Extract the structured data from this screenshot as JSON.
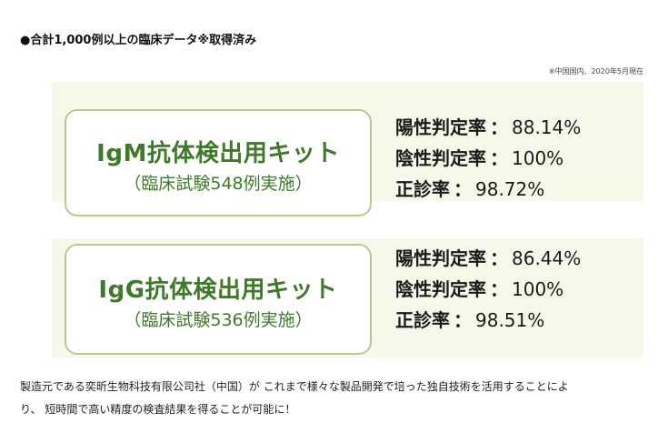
{
  "heading": "●合計1,000例以上の臨床データ※取得済み",
  "note": "※中国国内、2020年5月現在",
  "kits": [
    {
      "name": "IgM抗体検出用キット",
      "trial": "（臨床試験548例実施）",
      "stats": [
        {
          "label": "陽性判定率",
          "sep": "：",
          "value": "88.14%"
        },
        {
          "label": "陰性判定率",
          "sep": "：",
          "value": "100%"
        },
        {
          "label": "正診率",
          "sep": "：",
          "value": "98.72%"
        }
      ]
    },
    {
      "name": "IgG抗体検出用キット",
      "trial": "（臨床試験536例実施）",
      "stats": [
        {
          "label": "陽性判定率",
          "sep": "：",
          "value": "86.44%"
        },
        {
          "label": "陰性判定率",
          "sep": "：",
          "value": "100%"
        },
        {
          "label": "正診率",
          "sep": "：",
          "value": "98.51%"
        }
      ]
    }
  ],
  "body_text": [
    "製造元である奕昕生物科技有限公司社（中国）が これまで様々な製品開発で培った独自技術を活用することによ",
    "り、 短時間で高い精度の検査結果を得ることが可能に！"
  ],
  "colors": {
    "accent_green": "#3f7a2a",
    "box_border": "#b9c98b",
    "band_background": "#f7f8ea"
  }
}
